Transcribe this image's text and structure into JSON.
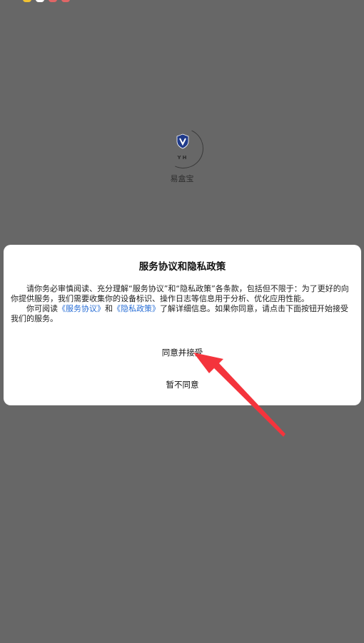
{
  "status": {
    "dot_colors": [
      "#f1c232",
      "#ffffff",
      "#e06666",
      "#e06666"
    ]
  },
  "splash": {
    "logo_initials": "YH",
    "app_name": "易盒宝"
  },
  "dialog": {
    "title": "服务协议和隐私政策",
    "paragraph1": "请你务必审慎阅读、充分理解“服务协议”和“隐私政策”各条款，包括但不限于：为了更好的向你提供服务，我们需要收集你的设备标识、操作日志等信息用于分析、优化应用性能。",
    "paragraph2_prefix": "你可阅读",
    "link_service": "《服务协议》",
    "paragraph2_and": "和",
    "link_privacy": "《隐私政策》",
    "paragraph2_suffix": "了解详细信息。如果你同意，请点击下面按钮开始接受我们的服务。",
    "accept_label": "同意并接受",
    "decline_label": "暂不同意"
  },
  "colors": {
    "backdrop": "#676767",
    "link": "#2a6fd6",
    "arrow": "#f4343c"
  }
}
